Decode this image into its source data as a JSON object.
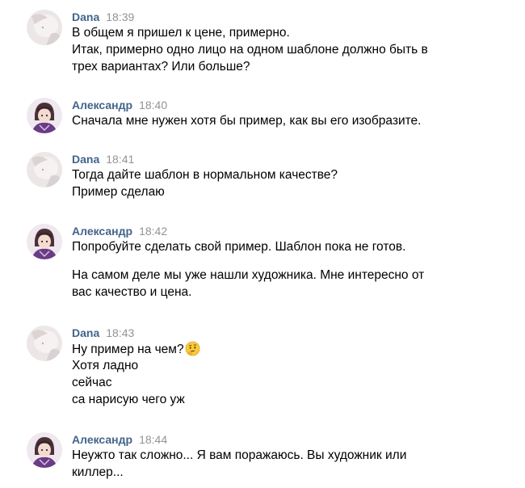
{
  "messages": [
    {
      "author": "Dana",
      "time": "18:39",
      "avatar": "dana-avatar",
      "lines": [
        "В общем я пришел к цене, примерно.",
        "Итак, примерно одно лицо на одном шаблоне должно быть в",
        "трех вариантах? Или больше?"
      ]
    },
    {
      "author": "Александр",
      "time": "18:40",
      "avatar": "aleksandr-avatar",
      "lines": [
        "Сначала мне нужен хотя бы пример, как вы его изобразите."
      ]
    },
    {
      "author": "Dana",
      "time": "18:41",
      "avatar": "dana-avatar",
      "lines": [
        "Тогда дайте шаблон в нормальном качестве?",
        "Пример сделаю"
      ]
    },
    {
      "author": "Александр",
      "time": "18:42",
      "avatar": "aleksandr-avatar",
      "lines": [
        "Попробуйте сделать свой пример. Шаблон пока не готов.",
        "На самом деле мы уже нашли художника. Мне интересно от",
        "вас качество и цена."
      ]
    },
    {
      "author": "Dana",
      "time": "18:43",
      "avatar": "dana-avatar",
      "lines": [
        "Ну пример на чем?",
        "Хотя ладно",
        "сейчас",
        "са нарисую чего уж"
      ],
      "emoji": "thinking-face-emoji"
    },
    {
      "author": "Александр",
      "time": "18:44",
      "avatar": "aleksandr-avatar",
      "lines": [
        "Неужто так сложно... Я вам поражаюсь. Вы художник или",
        "киллер..."
      ]
    }
  ],
  "colors": {
    "author": "#42648b",
    "time": "#939393",
    "text": "#000000",
    "background": "#ffffff"
  }
}
